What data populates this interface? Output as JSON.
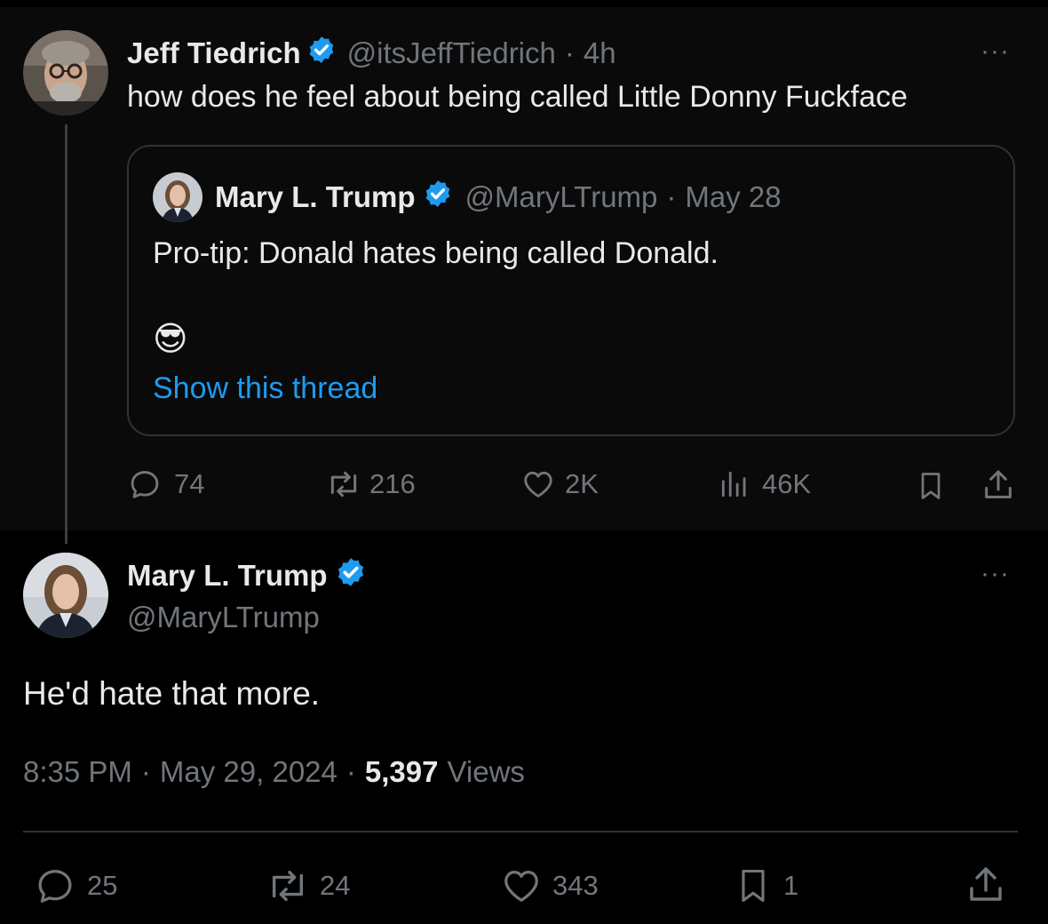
{
  "parent_tweet": {
    "author_name": "Jeff Tiedrich",
    "handle": "@itsJeffTiedrich",
    "separator": "·",
    "time": "4h",
    "text": "how does he feel about being called Little Donny Fuckface",
    "more_label": "···",
    "quoted": {
      "author_name": "Mary L. Trump",
      "handle": "@MaryLTrump",
      "separator": "·",
      "time": "May 28",
      "text": "Pro-tip: Donald hates being called Donald.",
      "emoji": "😎",
      "show_thread": "Show this thread"
    },
    "actions": {
      "replies": "74",
      "reposts": "216",
      "likes": "2K",
      "views": "46K"
    }
  },
  "main_tweet": {
    "author_name": "Mary L. Trump",
    "handle": "@MaryLTrump",
    "more_label": "···",
    "text": "He'd hate that more.",
    "time": "8:35 PM",
    "sep1": "·",
    "date": "May 29, 2024",
    "sep2": "·",
    "views_count": "5,397",
    "views_label": "Views",
    "actions": {
      "replies": "25",
      "reposts": "24",
      "likes": "343",
      "bookmarks": "1"
    }
  },
  "colors": {
    "background": "#000000",
    "parent_background": "#0a0a0a",
    "text": "#e7e9ea",
    "muted": "#71767b",
    "accent": "#1d9bf0",
    "border": "#2f3336"
  },
  "icons": [
    "verified-badge-icon",
    "reply-icon",
    "repost-icon",
    "like-icon",
    "views-icon",
    "bookmark-icon",
    "share-icon",
    "more-icon"
  ]
}
